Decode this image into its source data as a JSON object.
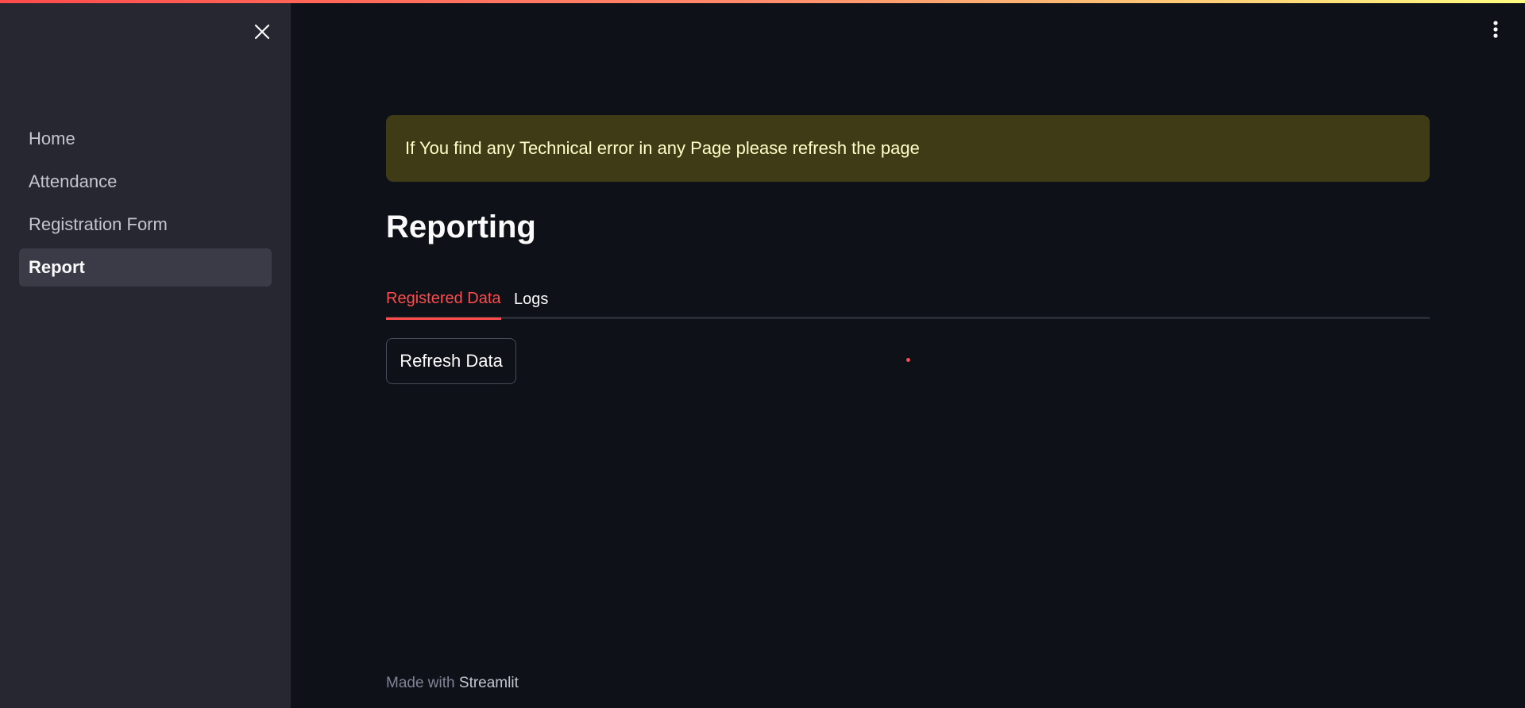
{
  "sidebar": {
    "items": [
      {
        "label": "Home"
      },
      {
        "label": "Attendance"
      },
      {
        "label": "Registration Form"
      },
      {
        "label": "Report"
      }
    ],
    "active_index": 3
  },
  "alert": {
    "text": "If You find any Technical error in any Page please refresh the page"
  },
  "page": {
    "title": "Reporting"
  },
  "tabs": [
    {
      "label": "Registered Data",
      "active": true
    },
    {
      "label": "Logs",
      "active": false
    }
  ],
  "actions": {
    "refresh_label": "Refresh Data"
  },
  "footer": {
    "prefix": "Made with",
    "brand": "Streamlit"
  },
  "icons": {
    "close": "close-icon",
    "menu": "kebab-menu-icon"
  },
  "colors": {
    "accent": "#ff4b4b",
    "background": "#0e1117",
    "sidebar": "#262730",
    "warning_bg": "#3e3b16",
    "warning_text": "#fffdc8"
  }
}
